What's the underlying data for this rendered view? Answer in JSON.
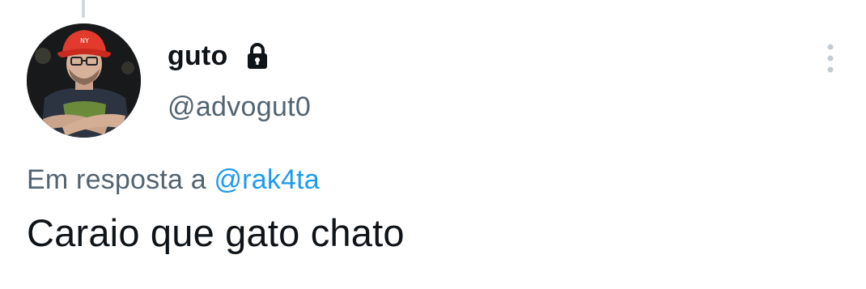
{
  "tweet": {
    "author": {
      "display_name": "guto",
      "handle": "@advogut0",
      "protected_icon": "lock-icon",
      "avatar_description": "man with glasses, red bucket hat, arms crossed"
    },
    "reply_prefix": "Em resposta a",
    "reply_to": "@rak4ta",
    "text": "Caraio que gato chato",
    "more_icon": "vertical-ellipsis-icon"
  },
  "colors": {
    "primary_text": "#0f1419",
    "secondary_text": "#536471",
    "link": "#1d9bf0",
    "thread_line": "#cfd9de"
  }
}
